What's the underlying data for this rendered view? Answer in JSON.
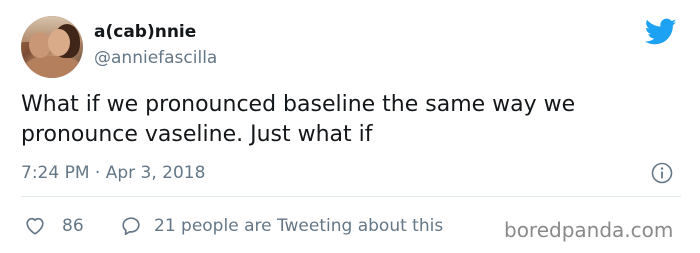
{
  "author": {
    "display_name": "a(cab)nnie",
    "handle": "@anniefascilla"
  },
  "tweet": {
    "text": "What if we pronounced baseline the same way we pronounce vaseline. Just what if",
    "timestamp": "7:24 PM · Apr 3, 2018"
  },
  "actions": {
    "likes_count": "86",
    "retweet_label": "21 people are Tweeting about this"
  },
  "watermark": "boredpanda.com",
  "icons": {
    "brand": "twitter-bird-icon",
    "info": "info-icon",
    "like": "heart-icon",
    "reply": "speech-bubble-icon"
  },
  "colors": {
    "twitter_blue": "#1da1f2",
    "secondary_text": "#657786",
    "primary_text": "#14171a",
    "divider": "#e1e8ed"
  }
}
